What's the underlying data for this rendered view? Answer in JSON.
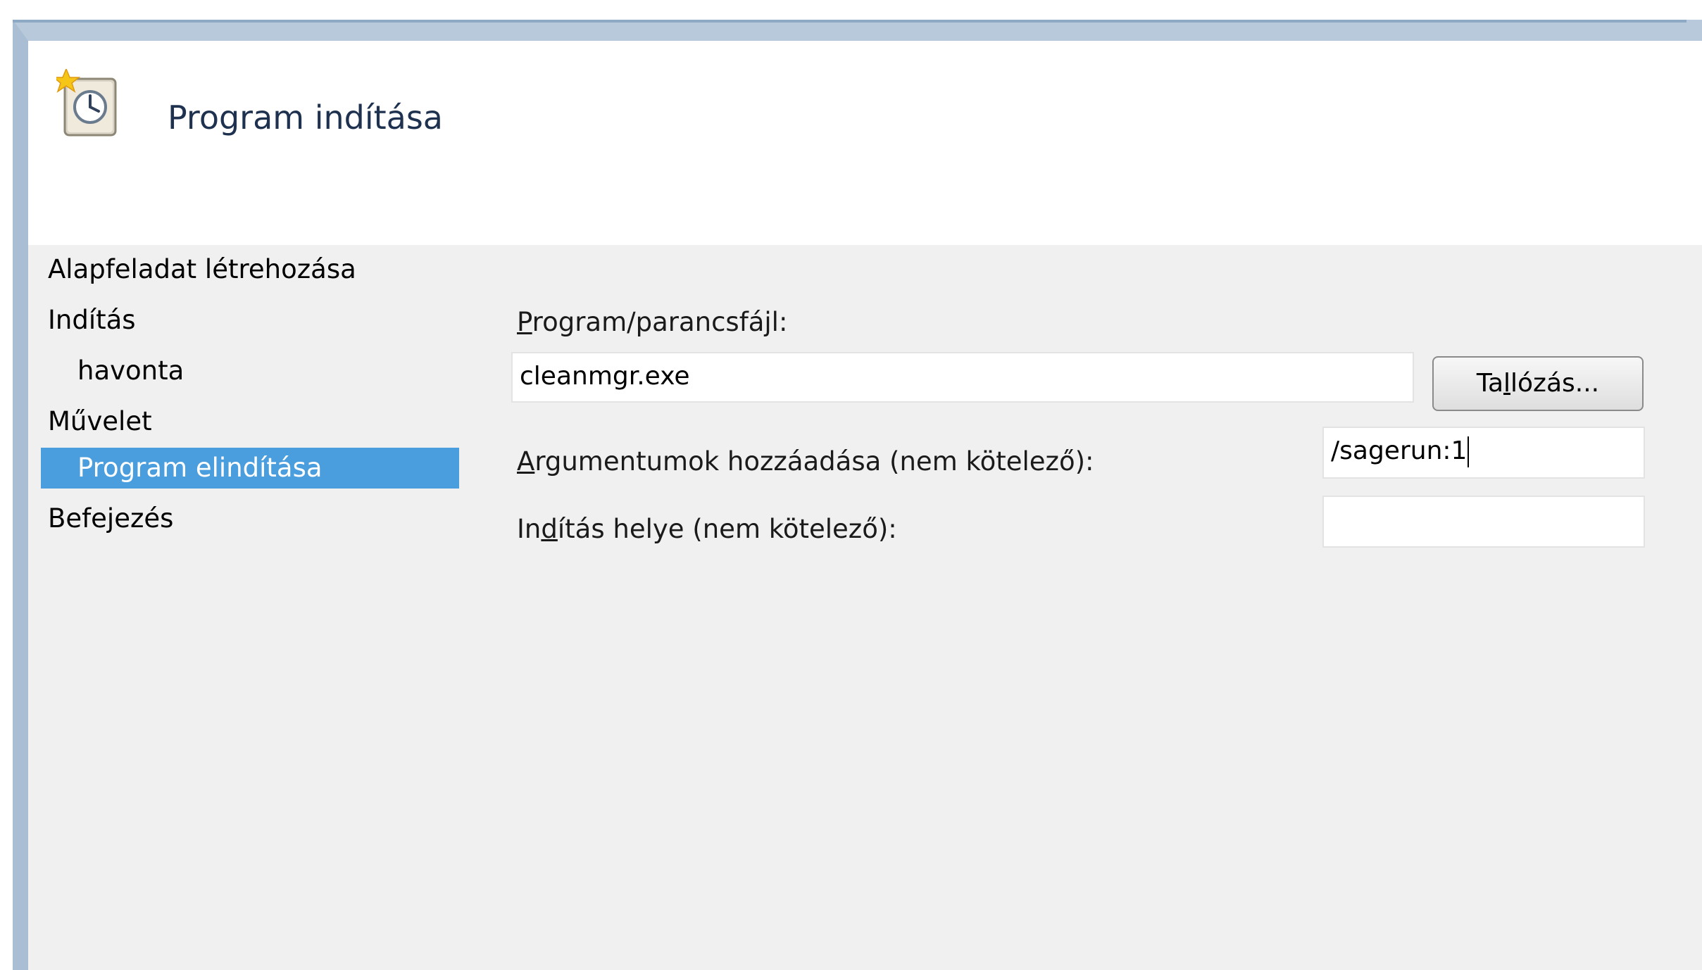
{
  "header": {
    "title": "Program indítása",
    "icon": "task-scheduler-clock-icon"
  },
  "sidebar": {
    "items": [
      {
        "label": "Alapfeladat létrehozása",
        "selected": false
      },
      {
        "label": "Indítás",
        "selected": false
      },
      {
        "label": "havonta",
        "selected": false
      },
      {
        "label": "Művelet",
        "selected": false
      },
      {
        "label": "Program elindítása",
        "selected": true
      },
      {
        "label": "Befejezés",
        "selected": false
      }
    ]
  },
  "form": {
    "program_label_accesskey": "P",
    "program_label_rest": "rogram/parancsfájl:",
    "program_value": "cleanmgr.exe",
    "browse_label_pre": "Ta",
    "browse_label_accesskey": "l",
    "browse_label_post": "lózás...",
    "args_label_accesskey": "A",
    "args_label_rest": "rgumentumok hozzáadása (nem kötelező):",
    "args_value": "/sagerun:1",
    "start_in_label_pre": "In",
    "start_in_label_accesskey": "d",
    "start_in_label_rest": "ítás helye (nem kötelező):",
    "start_in_value": ""
  },
  "colors": {
    "selection": "#4a9ede",
    "header_bg": "#ffffff",
    "body_bg": "#f0f0f0",
    "frame": "#a9bed2"
  }
}
